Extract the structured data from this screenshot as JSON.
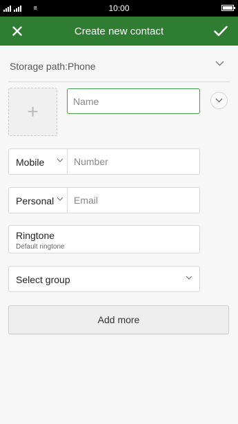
{
  "status_bar": {
    "time": "10:00",
    "sim_label": "B",
    "signal_icon": "cellular-signal-icon",
    "battery_icon": "battery-full-icon"
  },
  "app_bar": {
    "title": "Create new contact",
    "close_icon": "close-icon",
    "confirm_icon": "checkmark-icon",
    "color": "#2e7d32"
  },
  "storage": {
    "label": "Storage path:Phone",
    "icon": "chevron-down-icon"
  },
  "photo": {
    "icon": "plus-icon",
    "glyph": "+"
  },
  "name_field": {
    "value": "",
    "placeholder": "Name",
    "accent": "#3f9a45"
  },
  "expand": {
    "icon": "chevron-down-icon"
  },
  "phone": {
    "type": "Mobile",
    "value": "",
    "placeholder": "Number"
  },
  "email": {
    "type": "Personal",
    "value": "",
    "placeholder": "Email"
  },
  "ringtone": {
    "title": "Ringtone",
    "subtitle": "Default ringtone"
  },
  "group": {
    "label": "Select group",
    "icon": "chevron-down-icon"
  },
  "add_more": {
    "label": "Add more"
  }
}
